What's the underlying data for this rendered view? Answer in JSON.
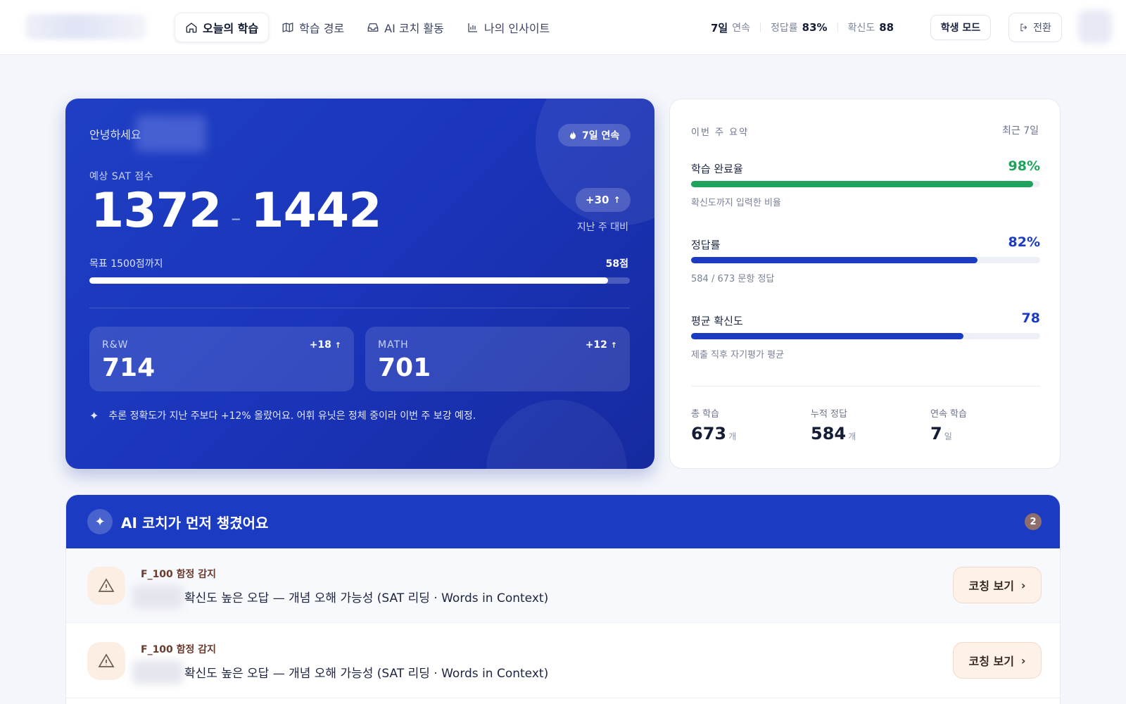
{
  "nav": {
    "items": [
      {
        "label": "오늘의 학습",
        "icon": "home-icon",
        "active": true
      },
      {
        "label": "학습 경로",
        "icon": "map-icon",
        "active": false
      },
      {
        "label": "AI 코치 활동",
        "icon": "inbox-icon",
        "active": false
      },
      {
        "label": "나의 인사이트",
        "icon": "bar-chart-icon",
        "active": false
      }
    ]
  },
  "header_stats": {
    "streak_value": "7일",
    "streak_label": "연속",
    "accuracy_label": "정답률",
    "accuracy_value": "83%",
    "confidence_label": "확신도",
    "confidence_value": "88",
    "mode_label": "학생 모드",
    "switch_label": "전환"
  },
  "hero": {
    "greeting": "안녕하세요",
    "streak_pill": "7일 연속",
    "sat_label": "예상 SAT 점수",
    "score_low": "1372",
    "score_dash": "–",
    "score_high": "1442",
    "delta": "+30",
    "delta_sub": "지난 주 대비",
    "goal_label": "목표 1500점까지",
    "goal_remaining": "58점",
    "goal_progress": 0.96,
    "subscores": [
      {
        "label": "R&W",
        "delta": "+18",
        "value": "714"
      },
      {
        "label": "MATH",
        "delta": "+12",
        "value": "701"
      }
    ],
    "note": "추론 정확도가 지난 주보다 +12% 올랐어요. 어휘 유닛은 정체 중이라 이번 주 보강 예정."
  },
  "summary": {
    "title": "이번 주 요약",
    "range": "최근 7일",
    "metrics": [
      {
        "label": "학습 완료율",
        "value": "98%",
        "progress": 0.98,
        "sub": "확신도까지 입력한 비율",
        "color": "#1fa35c"
      },
      {
        "label": "정답률",
        "value": "82%",
        "progress": 0.82,
        "sub": "584 / 673 문항 정답",
        "color": "#1b3cc2"
      },
      {
        "label": "평균 확신도",
        "value": "78",
        "progress": 0.78,
        "sub": "제출 직후 자기평가 평균",
        "color": "#1b3cc2"
      }
    ],
    "totals": [
      {
        "label": "총 학습",
        "value": "673",
        "unit": "개"
      },
      {
        "label": "누적 정답",
        "value": "584",
        "unit": "개"
      },
      {
        "label": "연속 학습",
        "value": "7",
        "unit": "일"
      }
    ]
  },
  "coach": {
    "title": "AI 코치가 먼저 챙겼어요",
    "count": "2",
    "alerts": [
      {
        "tag": "F_100 함정 감지",
        "text": "확신도 높은 오답 — 개념 오해 가능성 (SAT 리딩 · Words in Context)",
        "button": "코칭 보기"
      },
      {
        "tag": "F_100 함정 감지",
        "text": "확신도 높은 오답 — 개념 오해 가능성 (SAT 리딩 · Words in Context)",
        "button": "코칭 보기"
      }
    ]
  },
  "colors": {
    "brand": "#1b3cc2",
    "success": "#1fa35c",
    "warning_bg": "#fdeee3"
  }
}
